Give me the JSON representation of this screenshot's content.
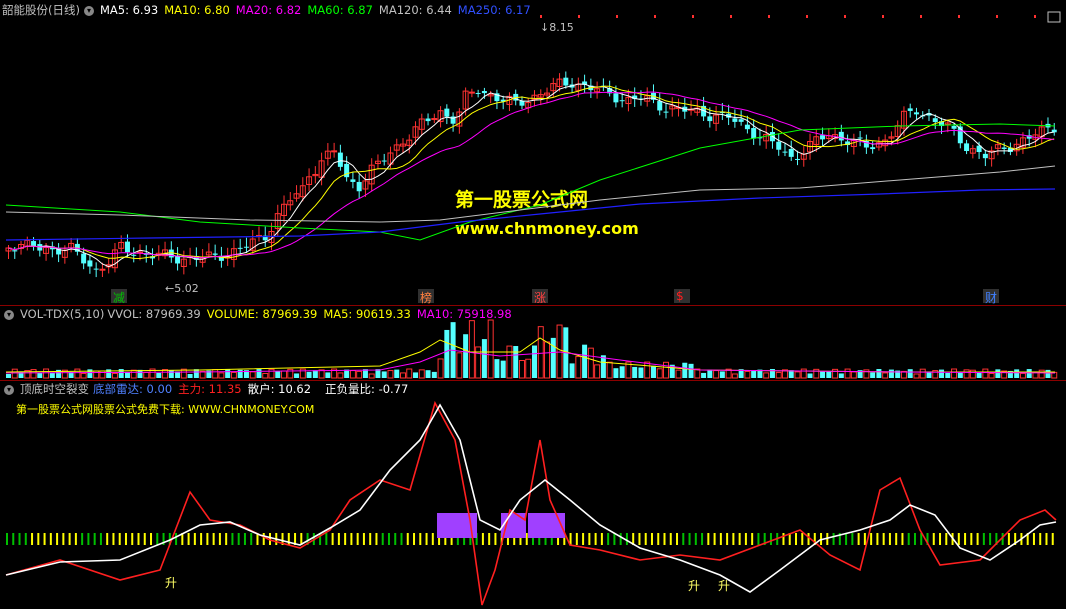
{
  "price_header": {
    "title": "韶能股份(日线)",
    "ma5": "MA5: 6.93",
    "ma10": "MA10: 6.80",
    "ma20": "MA20: 6.82",
    "ma60": "MA60: 6.87",
    "ma120": "MA120: 6.44",
    "ma250": "MA250: 6.17"
  },
  "price_labels": {
    "high": "8.15",
    "low": "5.02"
  },
  "watermark": {
    "cn": "第一股票公式网",
    "url": "www.chnmoney.com"
  },
  "events": [
    {
      "label": "减",
      "color": "#00c000"
    },
    {
      "label": "榜",
      "color": "#ff8040"
    },
    {
      "label": "涨",
      "color": "#ff4040"
    },
    {
      "label": "$",
      "color": "#ff2020"
    },
    {
      "label": "财",
      "color": "#4080ff"
    }
  ],
  "volume_header": {
    "name": "VOL-TDX(5,10)",
    "vvol": "VVOL: 87969.39",
    "volume": "VOLUME: 87969.39",
    "ma5": "MA5: 90619.33",
    "ma10": "MA10: 75918.98"
  },
  "indicator_header": {
    "name": "顶底时空裂变",
    "radar": "底部雷达: 0.00",
    "main": "主力: 11.35",
    "retail": "散户: 10.62",
    "ratio": "正负量比: -0.77",
    "promo": "第一股票公式网股票公式免费下载: WWW.CHNMONEY.COM"
  },
  "rise_marks": [
    "升",
    "升",
    "升"
  ],
  "colors": {
    "up": "#ff3232",
    "down": "#54ffff",
    "ma5": "#ffffff",
    "ma10": "#ffff00",
    "ma20": "#ff00ff",
    "ma60": "#00ff00",
    "ma120": "#c0c0c0",
    "ma250": "#2020ff",
    "main": "#ff2020",
    "retail": "#ffffff",
    "signal": "#a040ff"
  }
}
